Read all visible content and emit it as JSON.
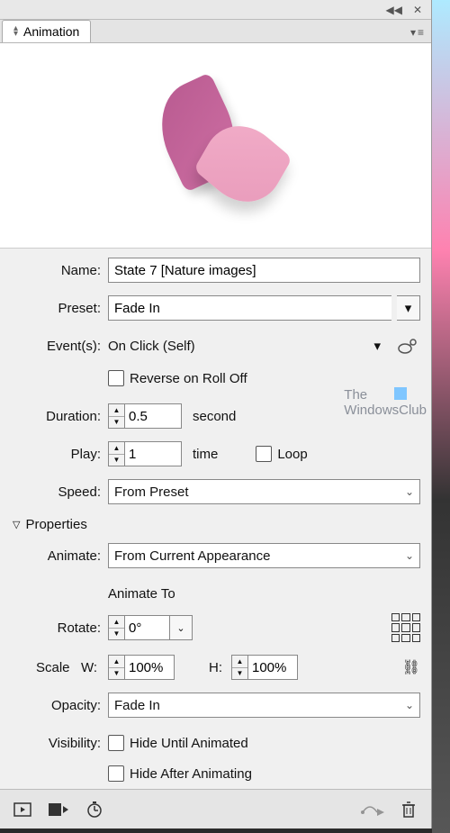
{
  "topbar": {
    "collapse_icon": "◀◀",
    "close_icon": "✕"
  },
  "tab": {
    "title": "Animation",
    "menu_icon": "▾≡"
  },
  "form": {
    "name": {
      "label": "Name:",
      "value": "State 7 [Nature images]"
    },
    "preset": {
      "label": "Preset:",
      "value": "Fade In"
    },
    "events": {
      "label": "Event(s):",
      "value": "On Click (Self)"
    },
    "reverse": {
      "label": "Reverse on Roll Off"
    },
    "duration": {
      "label": "Duration:",
      "value": "0.5",
      "unit": "second"
    },
    "play": {
      "label": "Play:",
      "value": "1",
      "unit": "time"
    },
    "loop": {
      "label": "Loop"
    },
    "speed": {
      "label": "Speed:",
      "value": "From Preset"
    }
  },
  "properties": {
    "header": "Properties",
    "animate": {
      "label": "Animate:",
      "value": "From Current Appearance"
    },
    "animate_to": "Animate To",
    "rotate": {
      "label": "Rotate:",
      "value": "0°"
    },
    "scale": {
      "label": "Scale",
      "w_label": "W:",
      "w_value": "100%",
      "h_label": "H:",
      "h_value": "100%"
    },
    "opacity": {
      "label": "Opacity:",
      "value": "Fade In"
    },
    "visibility": {
      "label": "Visibility:",
      "hide_until": "Hide Until Animated",
      "hide_after": "Hide After Animating"
    }
  },
  "watermark": {
    "line1": "The",
    "line2": "WindowsClub"
  },
  "footer": {
    "preview": "▣",
    "media": "▣→",
    "timing": "⏱",
    "convert": "⟿",
    "trash": "🗑"
  }
}
